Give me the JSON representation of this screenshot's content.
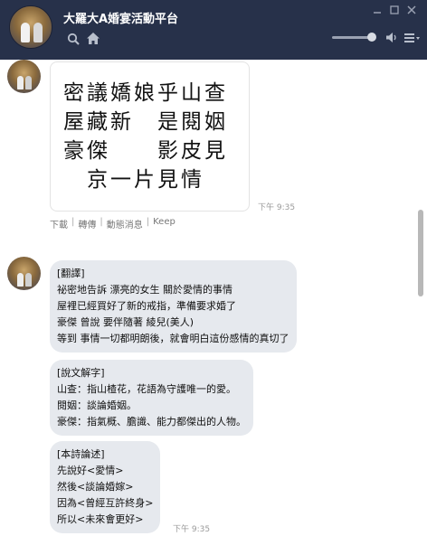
{
  "header": {
    "title": "大羅大A婚宴活動平台",
    "icons": [
      "search-icon",
      "home-icon",
      "volume-icon",
      "menu-icon",
      "minimize-icon",
      "maximize-icon",
      "close-icon"
    ]
  },
  "chat": {
    "image_message": {
      "poem_lines": [
        "密議嬌娘乎山查",
        "屋藏新　是閱姻",
        "豪傑　　影皮見",
        "　京一片見情　"
      ],
      "time": "下午 9:35"
    },
    "actions": [
      "下載",
      "轉傳",
      "動態消息",
      "Keep"
    ],
    "messages": [
      {
        "lines": [
          "[翻譯]",
          "祕密地告訴 漂亮的女生 關於愛情的事情",
          "屋裡已經買好了新的戒指，準備要求婚了",
          "豪傑 曾說 要伴隨著 綾兒(美人)",
          "等到 事情一切都明朗後，就會明白這份感情的真切了"
        ]
      },
      {
        "lines": [
          "[說文解字]",
          "山查：指山楂花，花語為守護唯一的愛。",
          "閱姻：談論婚姻。",
          "豪傑：指氣概、膽識、能力都傑出的人物。"
        ]
      },
      {
        "lines": [
          "[本詩論述]",
          "先說好<愛情>",
          "然後<談論婚嫁>",
          "因為<曾經互許終身>",
          "所以<未來會更好>"
        ],
        "time": "下午 9:35"
      }
    ]
  },
  "colors": {
    "header_bg": "#27314a",
    "bubble_bg": "#e6e9ee",
    "chat_bg": "#ffffff"
  }
}
